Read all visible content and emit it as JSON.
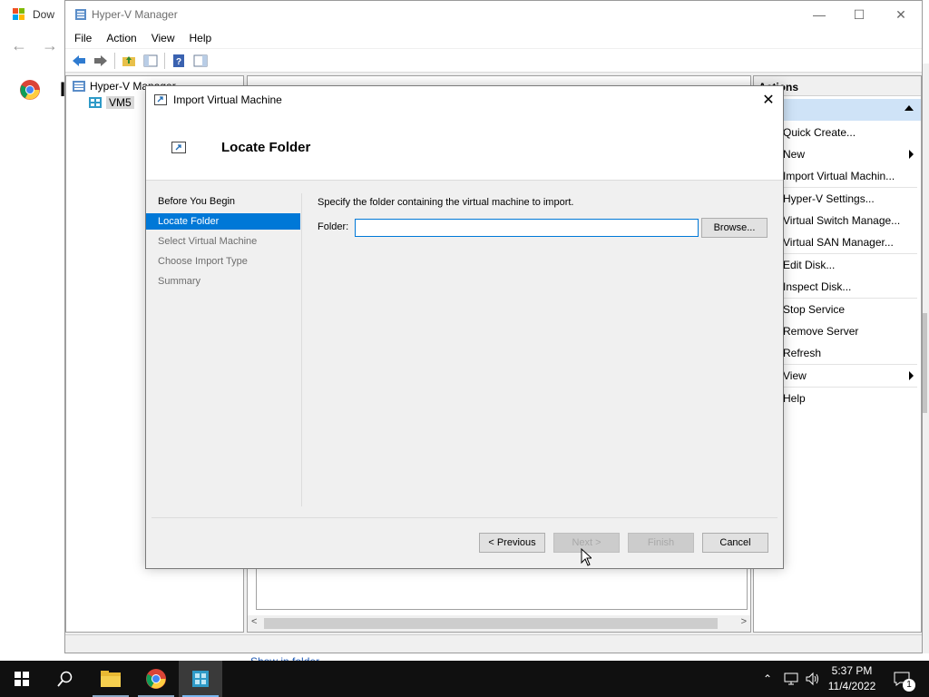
{
  "browser": {
    "tab_title": "Dow",
    "page_letter": "I",
    "bottom_link": "Show in folder"
  },
  "hyperv": {
    "title": "Hyper-V Manager",
    "menu": [
      "File",
      "Action",
      "View",
      "Help"
    ],
    "tree": {
      "root": "Hyper-V Manager",
      "server": "VM5"
    },
    "actions": {
      "header": "Actions",
      "items": [
        {
          "label": "Quick Create...",
          "submenu": false
        },
        {
          "label": "New",
          "submenu": true
        },
        {
          "label": "Import Virtual Machin...",
          "submenu": false
        },
        {
          "label": "Hyper-V Settings...",
          "submenu": false
        },
        {
          "label": "Virtual Switch Manage...",
          "submenu": false
        },
        {
          "label": "Virtual SAN Manager...",
          "submenu": false
        },
        {
          "label": "Edit Disk...",
          "submenu": false
        },
        {
          "label": "Inspect Disk...",
          "submenu": false
        },
        {
          "label": "Stop Service",
          "submenu": false
        },
        {
          "label": "Remove Server",
          "submenu": false
        },
        {
          "label": "Refresh",
          "submenu": false
        },
        {
          "label": "View",
          "submenu": true
        },
        {
          "label": "Help",
          "submenu": false
        }
      ]
    }
  },
  "dialog": {
    "title": "Import Virtual Machine",
    "heading": "Locate Folder",
    "steps": [
      {
        "label": "Before You Begin",
        "state": "done"
      },
      {
        "label": "Locate Folder",
        "state": "active"
      },
      {
        "label": "Select Virtual Machine",
        "state": "pending"
      },
      {
        "label": "Choose Import Type",
        "state": "pending"
      },
      {
        "label": "Summary",
        "state": "pending"
      }
    ],
    "instruction": "Specify the folder containing the virtual machine to import.",
    "folder_label": "Folder:",
    "folder_value": "",
    "browse_label": "Browse...",
    "buttons": {
      "previous": "< Previous",
      "next": "Next >",
      "finish": "Finish",
      "cancel": "Cancel"
    }
  },
  "taskbar": {
    "time": "5:37 PM",
    "date": "11/4/2022",
    "notification_count": "1"
  },
  "colors": {
    "accent": "#0078d7",
    "selection_bg": "#cfe3f7",
    "taskbar_bg": "#101010"
  }
}
